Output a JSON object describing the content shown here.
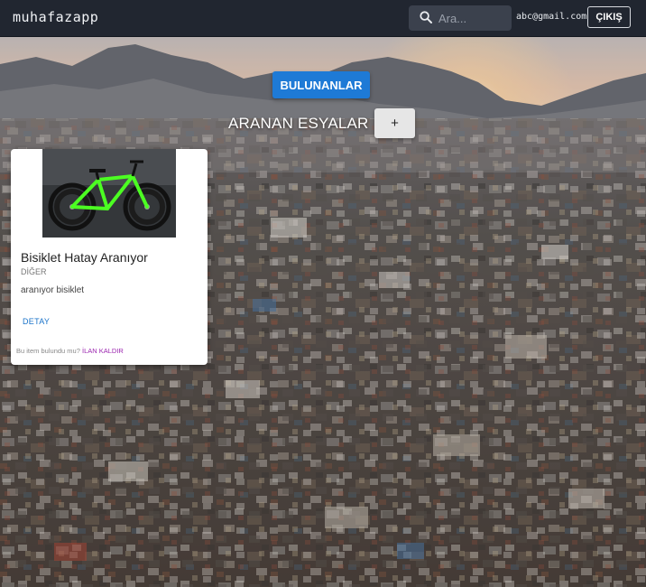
{
  "header": {
    "brand": "muhafazapp",
    "search_placeholder": "Ara...",
    "user_email": "abc@gmail.com",
    "logout_label": "ÇIKIŞ"
  },
  "main": {
    "found_button": "BULUNANLAR",
    "section_title": "ARANAN ESYALAR",
    "add_button": "+"
  },
  "card": {
    "title": "Bisiklet Hatay Aranıyor",
    "category": "DİĞER",
    "description": "aranıyor bisiklet",
    "detail_link": "DETAY",
    "footer_text": "Bu item bulundu mu?",
    "remove_link": "İLAN KALDIR"
  },
  "colors": {
    "topbar": "#212630",
    "primary_button": "#1e7ad6",
    "link": "#1a73c9",
    "remove_link": "#9c27b0"
  },
  "icons": {
    "search": "search-icon"
  }
}
